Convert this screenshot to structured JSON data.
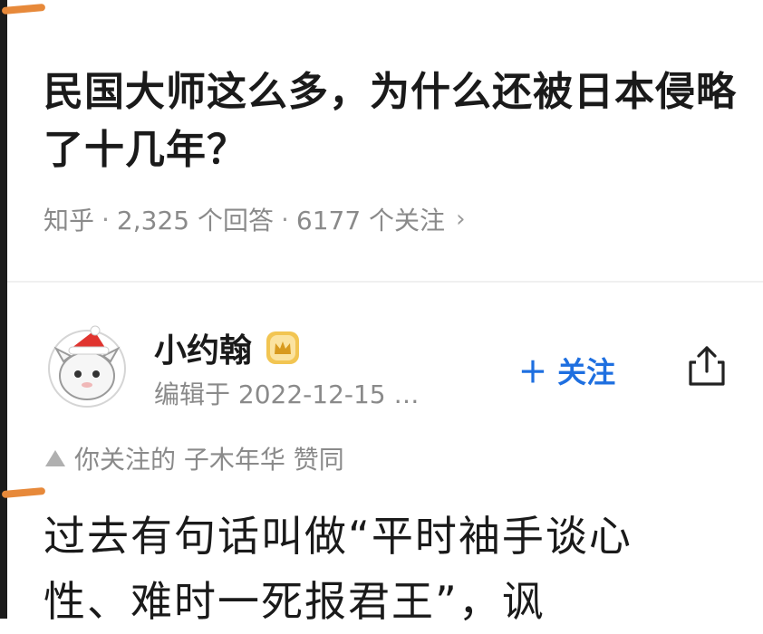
{
  "question": {
    "title": "民国大师这么多，为什么还被日本侵略了十几年？",
    "meta": {
      "platform": "知乎",
      "answers": "2,325 个回答",
      "followers": "6177 个关注",
      "chevron_icon": "chevron-right-icon"
    }
  },
  "author": {
    "name": "小约翰",
    "edited": "编辑于 2022-12-15 …",
    "badge_icon": "crown-badge-icon",
    "follow_label": "＋ 关注"
  },
  "upvote_line": {
    "text": "你关注的 子木年华 赞同"
  },
  "answer": {
    "text": "过去有句话叫做“平时袖手谈心性、难时一死报君王”，讽"
  },
  "colors": {
    "accent_blue": "#1e6fe0",
    "meta_gray": "#8a8a8a",
    "highlight_orange": "#e7893a"
  }
}
